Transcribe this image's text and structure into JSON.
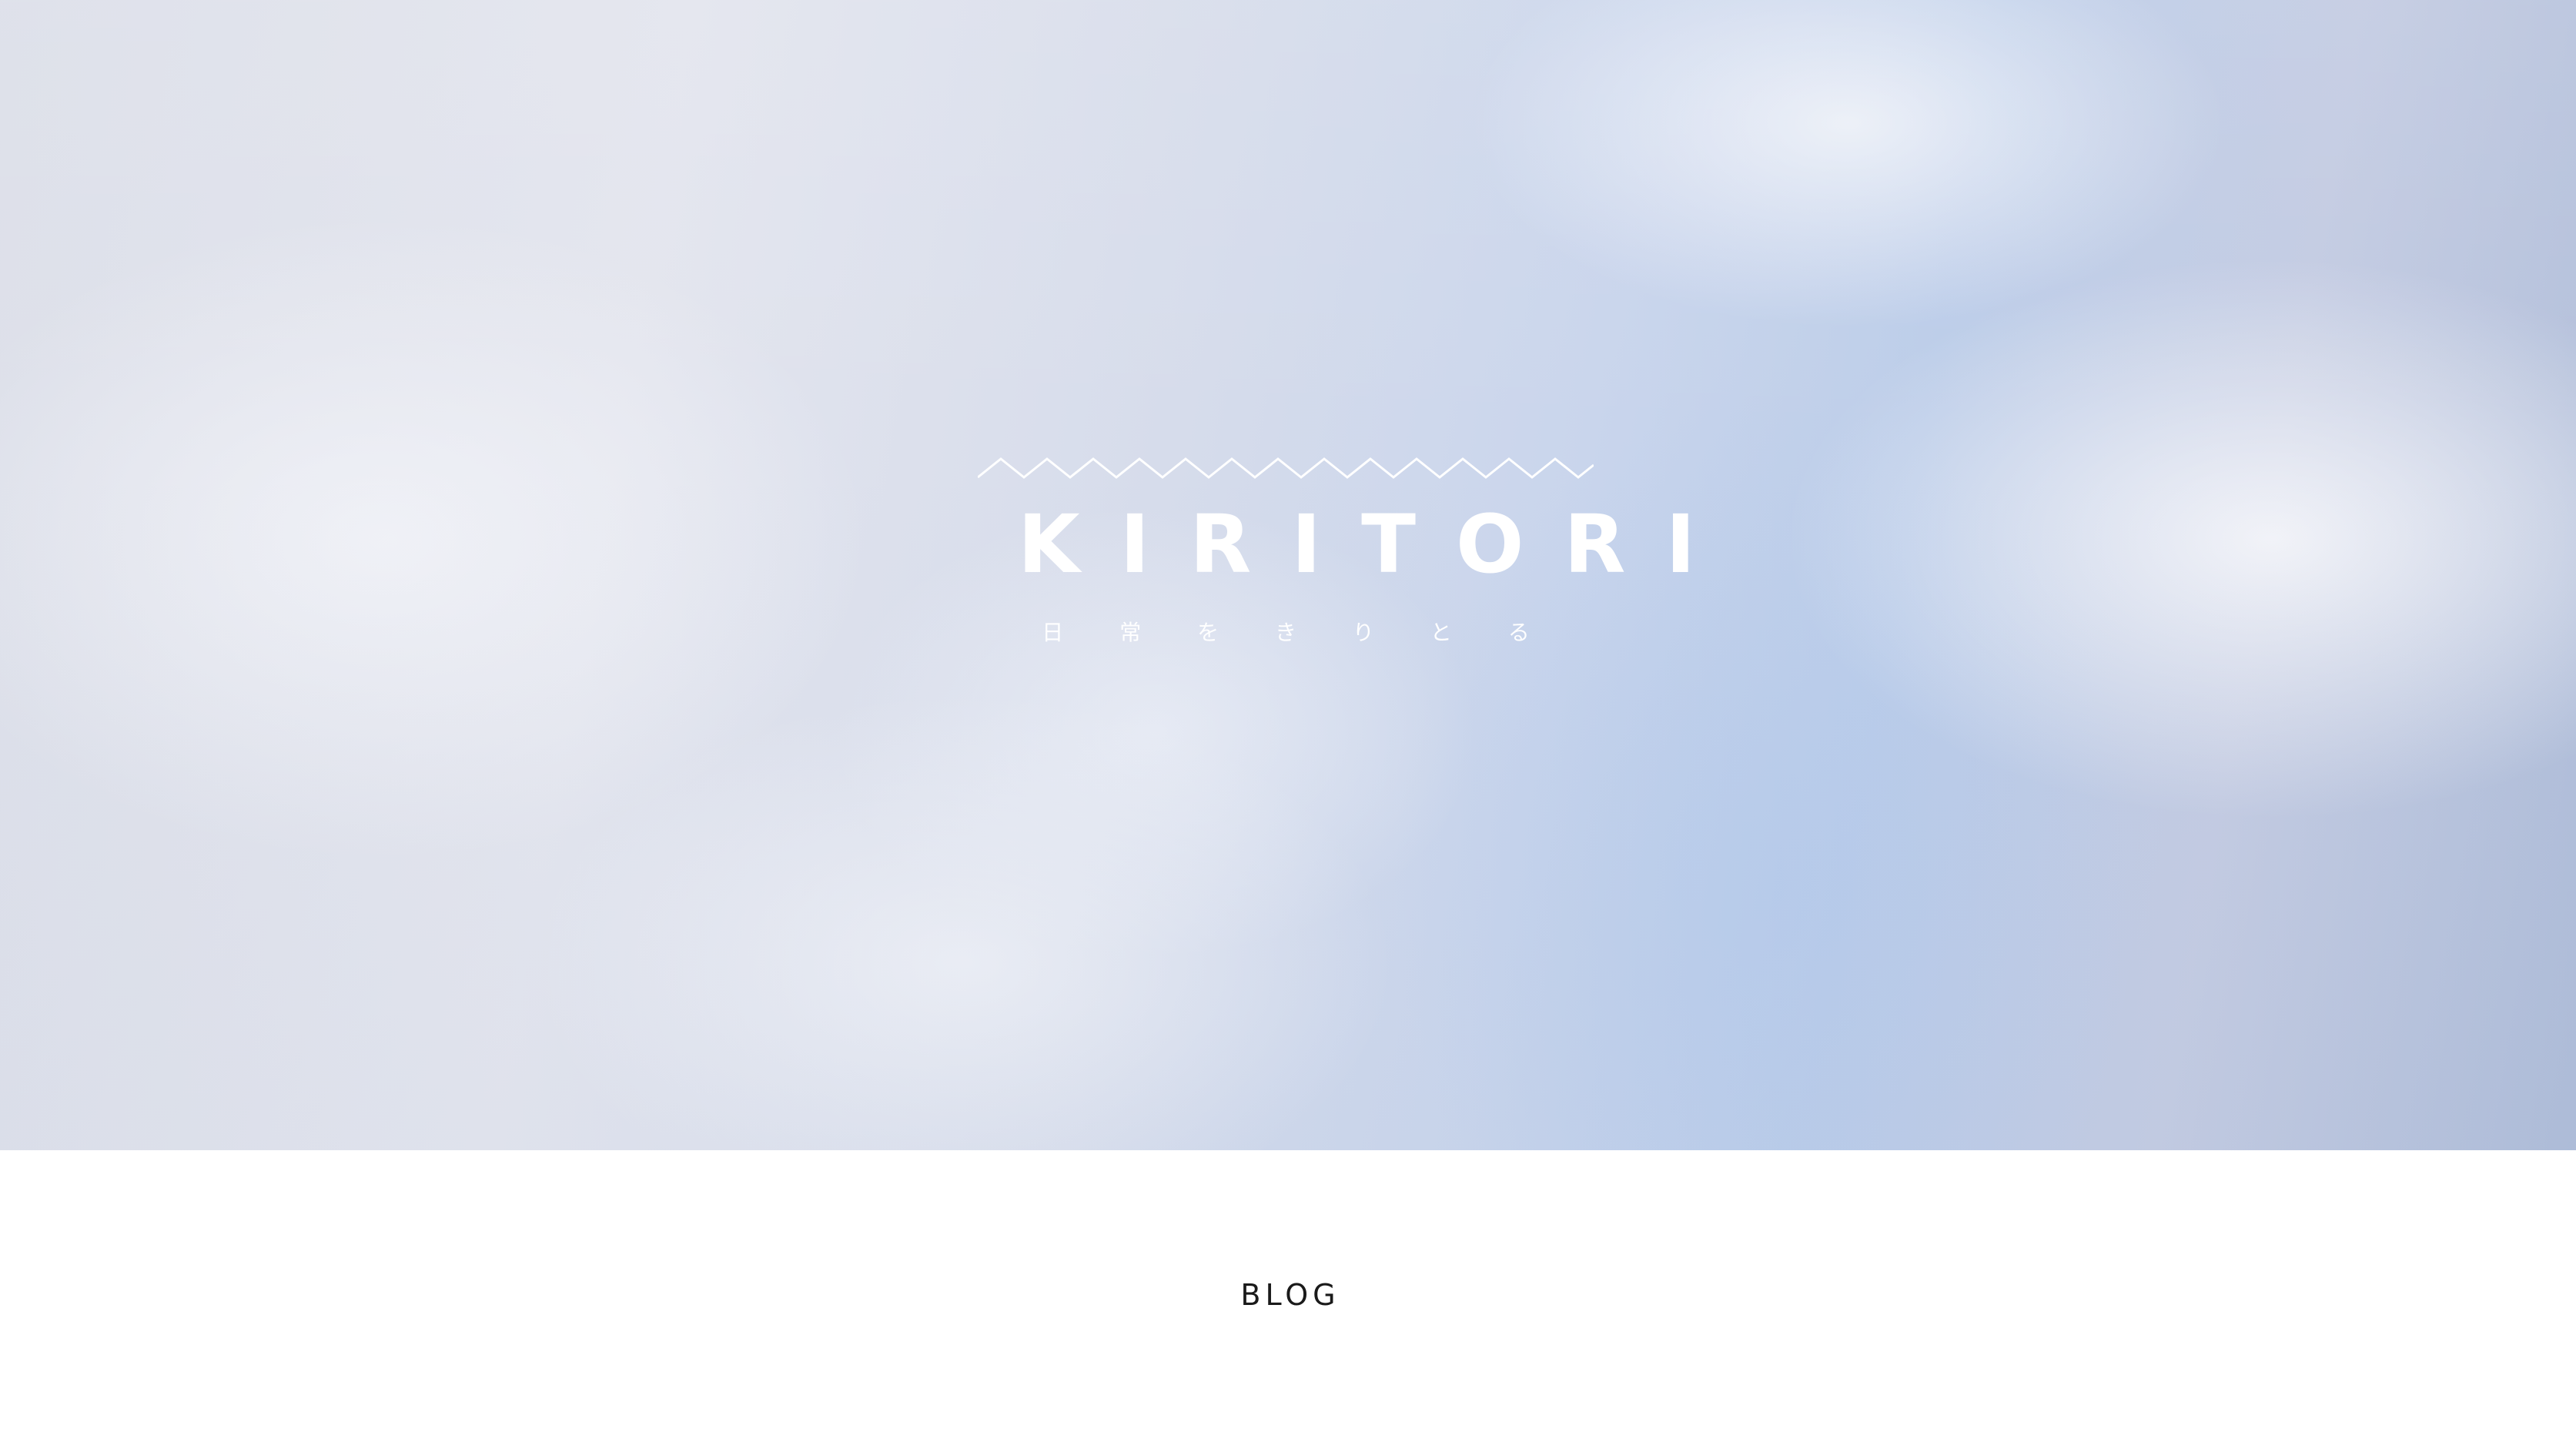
{
  "hero": {
    "brand_mark": "zigzag-line-icon",
    "title": "KIRITORI",
    "tagline": "日 常 を き り と る"
  },
  "main": {
    "section_heading": "BLOG"
  },
  "colors": {
    "hero_text": "#ffffff",
    "heading_text": "#1a1a1a",
    "sky_light": "#e3e5ee",
    "sky_blue": "#bccde9",
    "background": "#ffffff"
  }
}
